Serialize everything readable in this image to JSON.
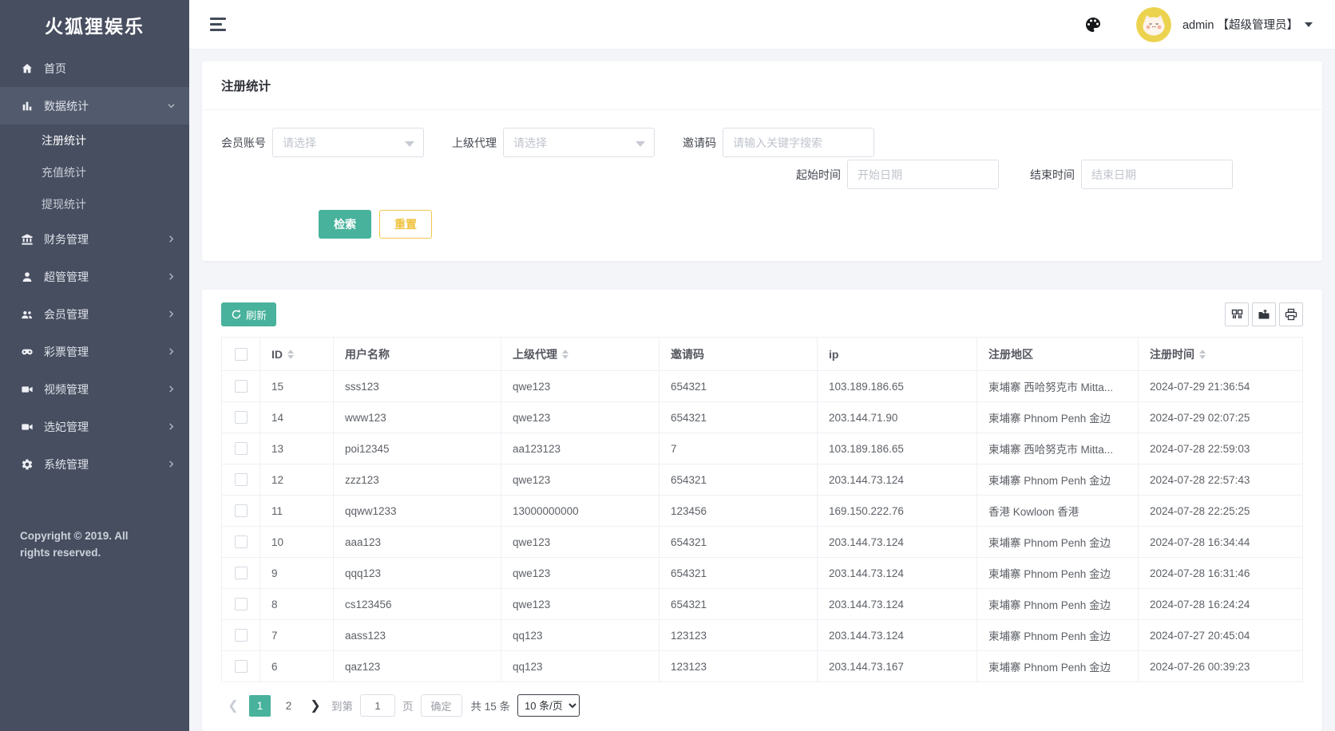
{
  "sidebar": {
    "logo": "火狐狸娱乐",
    "items": [
      {
        "label": "首页",
        "icon": "home-icon",
        "chevron": "none",
        "active": false,
        "children": []
      },
      {
        "label": "数据统计",
        "icon": "bar-chart-icon",
        "chevron": "down",
        "active": true,
        "children": [
          {
            "label": "注册统计",
            "active": true
          },
          {
            "label": "充值统计",
            "active": false
          },
          {
            "label": "提现统计",
            "active": false
          }
        ]
      },
      {
        "label": "财务管理",
        "icon": "bank-icon",
        "chevron": "right",
        "active": false,
        "children": []
      },
      {
        "label": "超管管理",
        "icon": "user-icon",
        "chevron": "right",
        "active": false,
        "children": []
      },
      {
        "label": "会员管理",
        "icon": "users-icon",
        "chevron": "right",
        "active": false,
        "children": []
      },
      {
        "label": "彩票管理",
        "icon": "gamepad-icon",
        "chevron": "right",
        "active": false,
        "children": []
      },
      {
        "label": "视频管理",
        "icon": "video-camera-icon",
        "chevron": "right",
        "active": false,
        "children": []
      },
      {
        "label": "选妃管理",
        "icon": "video-camera-icon",
        "chevron": "right",
        "active": false,
        "children": []
      },
      {
        "label": "系统管理",
        "icon": "gear-icon",
        "chevron": "right",
        "active": false,
        "children": []
      }
    ],
    "copyright": "Copyright © 2019. All rights reserved."
  },
  "topbar": {
    "icons": [
      "menu-icon",
      "palette-icon",
      "avatar"
    ],
    "username": "admin 【超级管理员】"
  },
  "filter": {
    "title": "注册统计",
    "member_label": "会员账号",
    "member_placeholder": "请选择",
    "agent_label": "上级代理",
    "agent_placeholder": "请选择",
    "invite_label": "邀请码",
    "invite_placeholder": "请输入关键字搜索",
    "start_label": "起始时间",
    "start_placeholder": "开始日期",
    "end_label": "结束时间",
    "end_placeholder": "结束日期",
    "search_button": "检索",
    "reset_button": "重置"
  },
  "table": {
    "refresh_button": "刷新",
    "tool_icons": [
      "columns-icon",
      "export-icon",
      "print-icon"
    ],
    "columns": [
      {
        "label": "ID",
        "sortable": true
      },
      {
        "label": "用户名称",
        "sortable": false
      },
      {
        "label": "上级代理",
        "sortable": true
      },
      {
        "label": "邀请码",
        "sortable": false
      },
      {
        "label": "ip",
        "sortable": false
      },
      {
        "label": "注册地区",
        "sortable": false
      },
      {
        "label": "注册时间",
        "sortable": true
      }
    ],
    "rows": [
      {
        "id": "15",
        "username": "sss123",
        "agent": "qwe123",
        "invite": "654321",
        "ip": "103.189.186.65",
        "region": "柬埔寨 西哈努克市 Mitta...",
        "time": "2024-07-29 21:36:54"
      },
      {
        "id": "14",
        "username": "www123",
        "agent": "qwe123",
        "invite": "654321",
        "ip": "203.144.71.90",
        "region": "柬埔寨 Phnom Penh 金边",
        "time": "2024-07-29 02:07:25"
      },
      {
        "id": "13",
        "username": "poi12345",
        "agent": "aa123123",
        "invite": "7",
        "ip": "103.189.186.65",
        "region": "柬埔寨 西哈努克市 Mitta...",
        "time": "2024-07-28 22:59:03"
      },
      {
        "id": "12",
        "username": "zzz123",
        "agent": "qwe123",
        "invite": "654321",
        "ip": "203.144.73.124",
        "region": "柬埔寨 Phnom Penh 金边",
        "time": "2024-07-28 22:57:43"
      },
      {
        "id": "11",
        "username": "qqww1233",
        "agent": "13000000000",
        "invite": "123456",
        "ip": "169.150.222.76",
        "region": "香港 Kowloon 香港",
        "time": "2024-07-28 22:25:25"
      },
      {
        "id": "10",
        "username": "aaa123",
        "agent": "qwe123",
        "invite": "654321",
        "ip": "203.144.73.124",
        "region": "柬埔寨 Phnom Penh 金边",
        "time": "2024-07-28 16:34:44"
      },
      {
        "id": "9",
        "username": "qqq123",
        "agent": "qwe123",
        "invite": "654321",
        "ip": "203.144.73.124",
        "region": "柬埔寨 Phnom Penh 金边",
        "time": "2024-07-28 16:31:46"
      },
      {
        "id": "8",
        "username": "cs123456",
        "agent": "qwe123",
        "invite": "654321",
        "ip": "203.144.73.124",
        "region": "柬埔寨 Phnom Penh 金边",
        "time": "2024-07-28 16:24:24"
      },
      {
        "id": "7",
        "username": "aass123",
        "agent": "qq123",
        "invite": "123123",
        "ip": "203.144.73.124",
        "region": "柬埔寨 Phnom Penh 金边",
        "time": "2024-07-27 20:45:04"
      },
      {
        "id": "6",
        "username": "qaz123",
        "agent": "qq123",
        "invite": "123123",
        "ip": "203.144.73.167",
        "region": "柬埔寨 Phnom Penh 金边",
        "time": "2024-07-26 00:39:23"
      }
    ]
  },
  "pagination": {
    "pages": [
      "1",
      "2"
    ],
    "active_page": "1",
    "goto_prefix": "到第",
    "goto_value": "1",
    "goto_suffix": "页",
    "confirm_label": "确定",
    "total_label": "共 15 条",
    "page_size_label": "10 条/页"
  },
  "colors": {
    "accent_green": "#48b29c",
    "accent_yellow": "#efc23d",
    "sidebar_bg": "#474e60",
    "avatar_bg": "#ecd34f"
  }
}
